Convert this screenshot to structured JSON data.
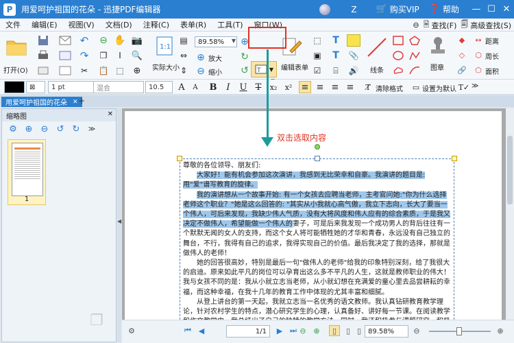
{
  "window": {
    "title": "用爱呵护祖国的花朵 - 迅捷PDF编辑器",
    "logo_text": "P",
    "user": "Z",
    "buy_vip": "购买VIP",
    "help": "帮助",
    "min": "—",
    "max": "☐",
    "close": "✕"
  },
  "menu": {
    "items": [
      "文件",
      "编辑(E)",
      "视图(V)",
      "文档(D)",
      "注释(C)",
      "表单(R)",
      "工具(T)",
      "窗口(W)"
    ],
    "find": "查找(F)",
    "advanced_find": "高级查找(S)"
  },
  "ribbon": {
    "open": "打开(O)",
    "actual_size": "实际大小",
    "zoom_value": "89.58%",
    "zoom_in": "放大",
    "zoom_out": "缩小",
    "edit_form": "编辑表单",
    "lines": "线条",
    "stamp": "图章",
    "distance": "距离",
    "perimeter": "周长",
    "area": "面积"
  },
  "format": {
    "stroke_width": "1 pt",
    "blend": "混合",
    "font_size": "10.5",
    "clear_format": "清除格式",
    "set_default": "设置为默认"
  },
  "tab": {
    "name": "用爱呵护祖国的花朵",
    "close": "✕",
    "new": "+"
  },
  "thumbnails": {
    "header": "缩略图",
    "page_label": "1"
  },
  "annotation": "双击选取内容",
  "document": {
    "paragraphs": [
      {
        "text": "尊敬的各位领导、朋友们:",
        "hl": false
      },
      {
        "text": "大家好！能有机会参加这次演讲，我感到无比荣幸和自豪。我演讲的题目是: 用\"爱\"谱写教育的旋律。",
        "hl": true
      },
      {
        "text": "我的演讲想从一个故事开始: 有一个女孩去应聘当老师，主考官问她:\"你为什么选择老师这个职业？\"她是这么回答的: \"其实从小我就心高气傲，我立下志向，长大了要当一个伟人，可后来发现，我缺少伟人气质，没有大将风度和伟人应有的综合素质，于是我又决定不做伟人，希望能做一个伟人的妻子，可是后来我发现一个成功男人的背后往往有一个默默无闻的女人的支持，而这个女人将可能牺牲她的才华和青春，永远没有自己独立的舞台，不行，我得有自己的追求，我得实现自己的价值。最后我决定了我的选择，那就是做伟人的老师！",
        "hl": false
      },
      {
        "text": "她的回答很高妙，特别是最后一句\"做伟人的老师\"给我的印象特别深刻，给了我很大的启迪。原来如此平凡的岗位可以孕育出这么多不平凡的人生，这就是教师职业的伟大！我与女孩不同的是：我从小就立志当老师，从小就幻想在充满爱的童心里去品尝耕耘的幸福，而这种幸福，在我十几年的教育工作中体现的尤其丰富和细腻。",
        "hl": false
      },
      {
        "text": "从登上讲台的第一天起，我就立志当一名优秀的语文教师。我认真钻研教育教学理论，针对农村学生的特点，潜心研究学生的心理，认真备好、讲好每一节课。在阅读教学和作文教学中，我总结出了自己的独特的教学方法。同时，我还积极参与课题研究，积极撰写教学",
        "hl": false
      }
    ]
  },
  "status": {
    "page": "1/1",
    "zoom": "89.58%"
  }
}
